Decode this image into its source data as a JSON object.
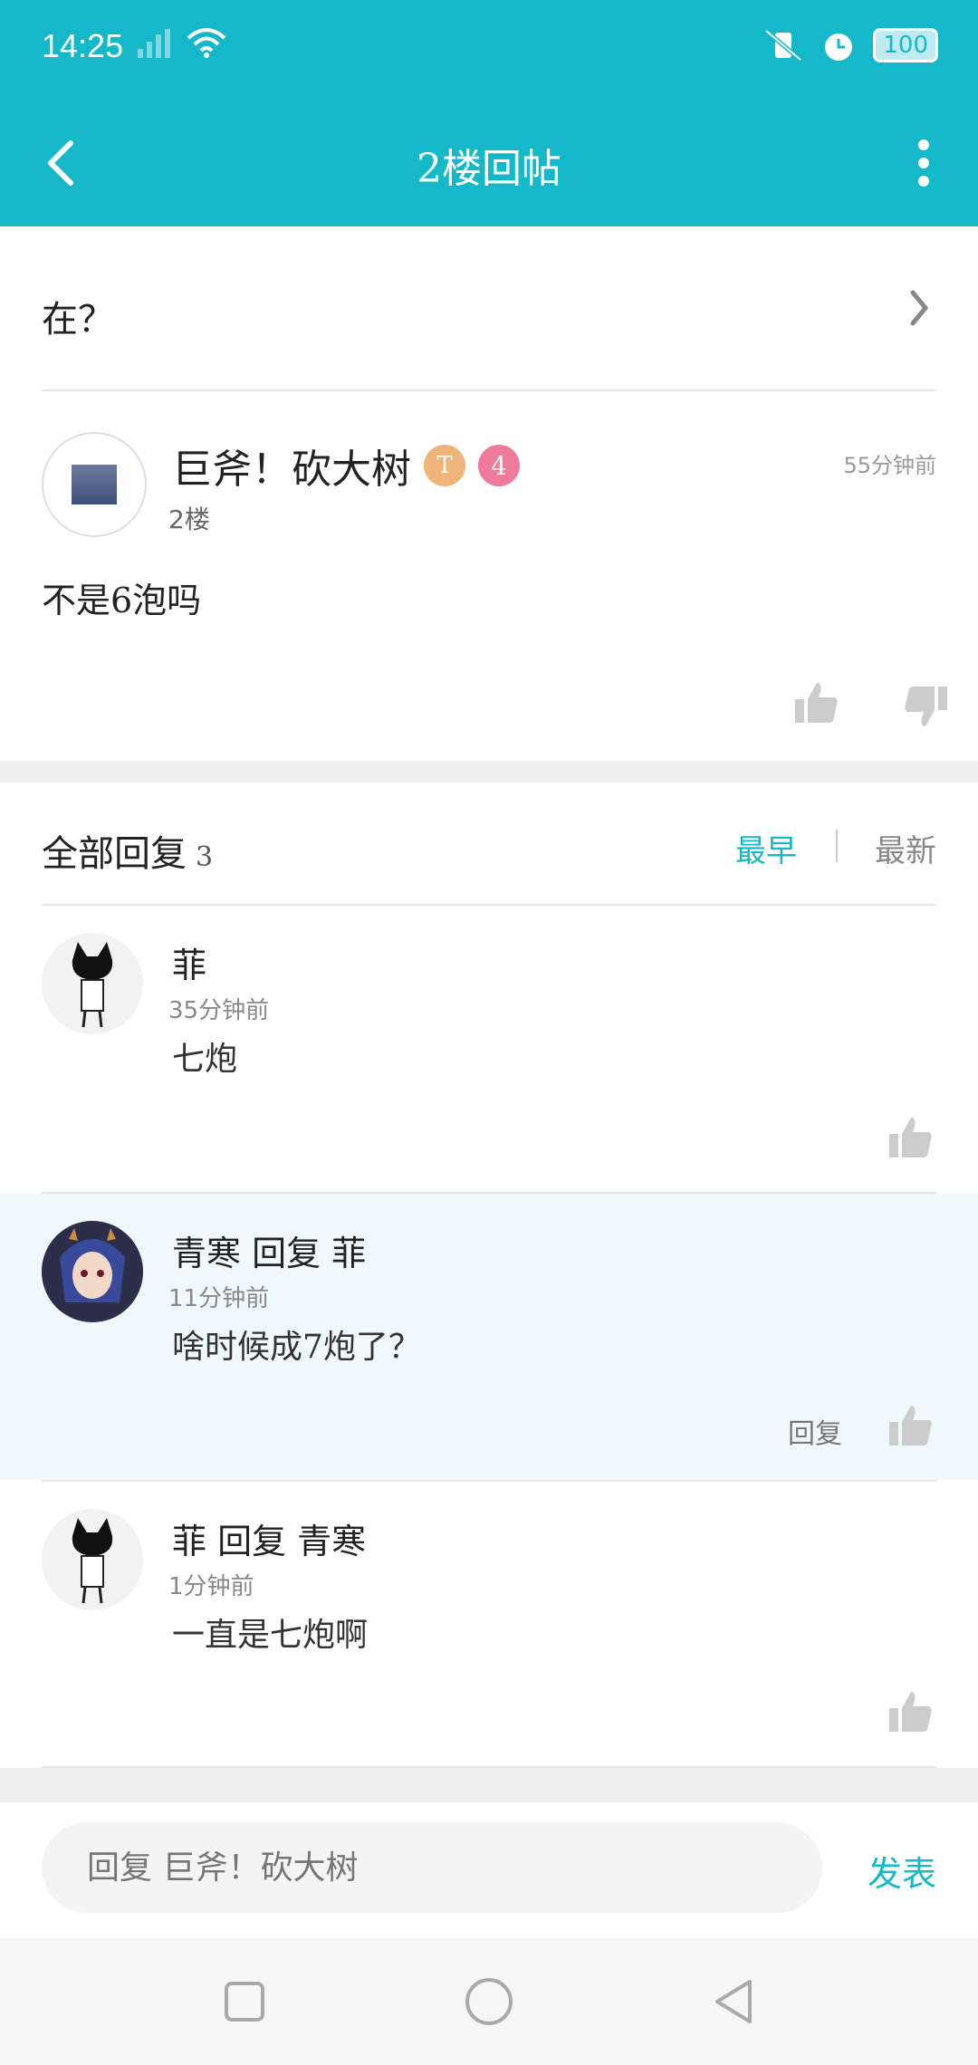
{
  "status": {
    "time": "14:25",
    "battery": "100"
  },
  "appbar": {
    "title": "2楼回帖"
  },
  "topic": {
    "text": "在？"
  },
  "main_post": {
    "author": "巨斧！砍大树",
    "badge_t": "T",
    "badge_level": "4",
    "floor": "2楼",
    "time": "55分钟前",
    "content": "不是6泡吗"
  },
  "replies_header": {
    "title": "全部回复",
    "count": "3",
    "sort_earliest": "最早",
    "sort_newest": "最新"
  },
  "replies": [
    {
      "name": "菲",
      "time": "35分钟前",
      "content": "七炮"
    },
    {
      "name": "青寒 回复 菲",
      "time": "11分钟前",
      "content": "啥时候成7炮了？",
      "reply_label": "回复"
    },
    {
      "name": "菲 回复 青寒",
      "time": "1分钟前",
      "content": "一直是七炮啊"
    }
  ],
  "composer": {
    "placeholder": "回复 巨斧！砍大树",
    "send": "发表"
  },
  "colors": {
    "accent": "#15b8c9",
    "divider": "#e6e6e6",
    "highlight_row": "#eff8fa"
  }
}
